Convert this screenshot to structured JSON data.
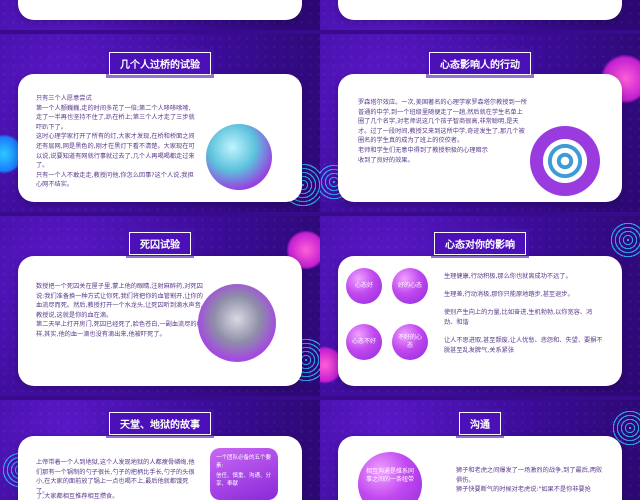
{
  "slides": {
    "s2": {
      "title": "几个人过桥的试验",
      "text": "只有三个人愿意尝试\n第一个人颤巍巍,走的时间多花了一倍;第二个人哆哆嗦嗦,走了一半再也坚持不住了,趴在桥上;第三个人才走了三步就吓趴下了。\n这时心理学家打开了所有的灯,大家才发现,在桥和桥面之间还有层网,网是黑色的,刚才在黑灯下看不清楚。大家现在可以说,说要知道有网就行事就过去了,几个人再喝喝都走过来了。\n只有一个人不敢走走,教授问他,你怎么回事?这个人说,我担心网不结实。"
    },
    "s3": {
      "title": "心态影响人的行动",
      "text": "罗森塔尔效应。一次,美国著名的心理学家罗森塔尔教授到一所普通的中学,到一个班级里随便走了一趟,然后就在学生名单上圈了几个名字,对老师说这几个孩子智商很高,非常聪明,是天才。过了一段时间,教授又来到这所中学,奇迹发生了,那几个被圈名的学生真的成为了班上的佼佼者。\n老师和学生们无意中得到了教授积极的心理暗示\n收到了良好的效果。"
    },
    "s4": {
      "title": "死囚试验",
      "text": "数授把一个死囚关在屋子里,蒙上他的眼睛,注射麻醉药,对死囚说:我们准备换一种方式让你死,我们将把你的血管割开,让你的血流尽而死。然后,教授打开一个水龙头,让死囚听到滴水声音,教授说,这就是你的血在滴。\n第二天早上打开房门,死囚已经死了,脸色苍白,一副血流尽的模样,其实,他的血一滴也没有滴出来,他被吓死了。"
    },
    "s5": {
      "title": "心态对你的影响",
      "circles": [
        "心态好",
        "好的心态",
        "心态不好",
        "不好的心态"
      ],
      "lines": [
        "生理健康,行动积极,那么你也就离成功不远了。",
        "生理差,行动消极,那你只能原地踏步,甚至退步。",
        "使别产生向上的力量,比如奋进,生机勃勃,以你宽容、鸿劲、和谐",
        "让人不思进取,甚至颓废,让人忧愁、悲怨和、失望、要摒不脱甚至乱发脾气,关系紧张"
      ]
    },
    "s6": {
      "title": "天堂、地狱的故事",
      "text": "上帝带着一个人到地狱,这个人发现地狱的人都瘦骨嶙峋,他们那有一个锅制的勺子很长,勺子的把柄比手长,勺子的头很小,在大家的面前放了锅上一点也喝不上,最后他就都饿死了。",
      "text2": "了,大家都相互推荐相互攒食。",
      "box_title": "一个团队必备的五个要素:",
      "box_items": "信任、慎重、沟通、分享、奉献"
    },
    "s7": {
      "title": "沟通",
      "ball_text": "相互沟通是维系同事之间的一条纽带",
      "text": "狮子和老虎之间爆发了一场激烈的战争,到了最后,两败俱伤。\n狮子快要断气的时候对老虎说:\"如果不是你非要抢"
    }
  }
}
